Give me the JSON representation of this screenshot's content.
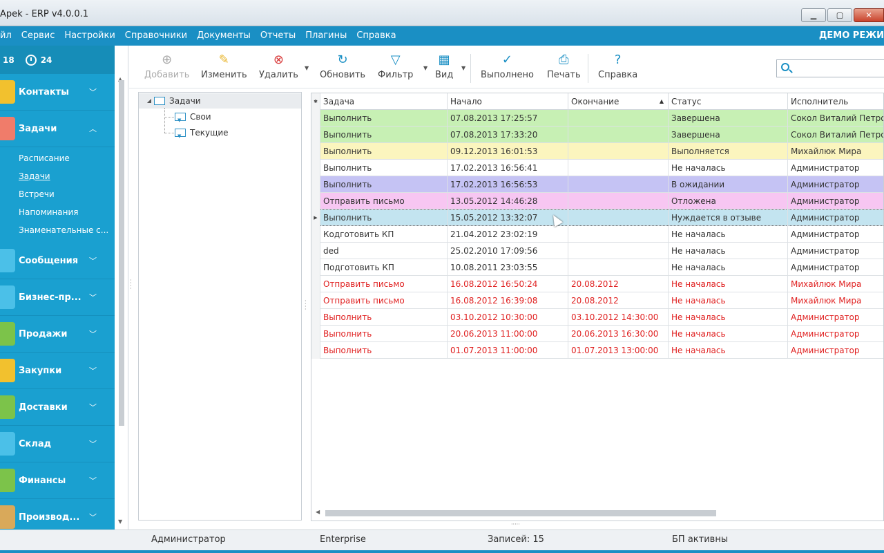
{
  "window": {
    "title": "Apek - ERP v4.0.0.1",
    "buttons": [
      {
        "name": "minimize-button",
        "glyph": "▁"
      },
      {
        "name": "maximize-button",
        "glyph": "▢"
      },
      {
        "name": "close-button",
        "glyph": "✕"
      }
    ]
  },
  "menubar": {
    "items": [
      "йл",
      "Сервис",
      "Настройки",
      "Справочники",
      "Документы",
      "Отчеты",
      "Плагины",
      "Справка"
    ],
    "mode_label": "ДЕМО РЕЖИ"
  },
  "sidebar": {
    "counter_left": "18",
    "counter_right": "24",
    "sections": [
      {
        "label": "Контакты",
        "color": "#f2c12e",
        "icon": "contacts-icon"
      },
      {
        "label": "Задачи",
        "color": "#f07c6a",
        "icon": "tasks-icon",
        "expanded": true,
        "items": [
          "Расписание",
          "Задачи",
          "Встречи",
          "Напоминания",
          "Знаменательные с..."
        ],
        "active_item": 1
      },
      {
        "label": "Сообщения",
        "color": "#4bc0e8",
        "icon": "messages-icon"
      },
      {
        "label": "Бизнес-пр...",
        "color": "#4bc0e8",
        "icon": "business-process-icon"
      },
      {
        "label": "Продажи",
        "color": "#7cc34a",
        "icon": "sales-icon"
      },
      {
        "label": "Закупки",
        "color": "#f2c12e",
        "icon": "purchases-icon"
      },
      {
        "label": "Доставки",
        "color": "#7cc34a",
        "icon": "delivery-icon"
      },
      {
        "label": "Склад",
        "color": "#4bc0e8",
        "icon": "warehouse-icon"
      },
      {
        "label": "Финансы",
        "color": "#7cc34a",
        "icon": "finance-icon"
      },
      {
        "label": "Производ...",
        "color": "#d9a95a",
        "icon": "production-icon"
      }
    ]
  },
  "toolbar": {
    "buttons": [
      {
        "label": "Добавить",
        "icon": "plus-icon",
        "glyph": "⊕",
        "color": "#aaaaaa",
        "disabled": true
      },
      {
        "label": "Изменить",
        "icon": "pencil-icon",
        "glyph": "✎",
        "color": "#e8b42a"
      },
      {
        "label": "Удалить",
        "icon": "delete-icon",
        "glyph": "⊗",
        "color": "#d83a3a",
        "dropdown": true
      },
      {
        "label": "Обновить",
        "icon": "refresh-icon",
        "glyph": "↻",
        "color": "#1a8fc4"
      },
      {
        "label": "Фильтр",
        "icon": "filter-icon",
        "glyph": "▽",
        "color": "#1a8fc4",
        "dropdown": true
      },
      {
        "label": "Вид",
        "icon": "view-icon",
        "glyph": "▦",
        "color": "#1a8fc4",
        "dropdown": true
      },
      {
        "label": "Выполнено",
        "icon": "check-icon",
        "glyph": "✓",
        "color": "#1a8fc4"
      },
      {
        "label": "Печать",
        "icon": "print-icon",
        "glyph": "⎙",
        "color": "#1a8fc4"
      },
      {
        "label": "Справка",
        "icon": "help-icon",
        "glyph": "?",
        "color": "#1a8fc4"
      }
    ],
    "search": {
      "value": "",
      "placeholder": ""
    }
  },
  "tree": {
    "root": "Задачи",
    "children": [
      "Свои",
      "Текущие"
    ]
  },
  "grid": {
    "columns": [
      "Задача",
      "Начало",
      "Окончание",
      "Статус",
      "Исполнитель"
    ],
    "sorted_column_glyph": "▲",
    "rows": [
      {
        "task": "Выполнить",
        "start": "07.08.2013 17:25:57",
        "end": "",
        "status": "Завершена",
        "assignee": "Сокол Виталий Петро",
        "bg": "#c7f0b4",
        "fg": "#333333"
      },
      {
        "task": "Выполнить",
        "start": "07.08.2013 17:33:20",
        "end": "",
        "status": "Завершена",
        "assignee": "Сокол Виталий Петро",
        "bg": "#c7f0b4",
        "fg": "#333333"
      },
      {
        "task": "Выполнить",
        "start": "09.12.2013 16:01:53",
        "end": "",
        "status": "Выполняется",
        "assignee": "Михайлюк Мира",
        "bg": "#fbf5be",
        "fg": "#333333"
      },
      {
        "task": "Выполнить",
        "start": "17.02.2013 16:56:41",
        "end": "",
        "status": "Не началась",
        "assignee": "Администратор",
        "bg": "#ffffff",
        "fg": "#333333"
      },
      {
        "task": "Выполнить",
        "start": "17.02.2013 16:56:53",
        "end": "",
        "status": "В ожидании",
        "assignee": "Администратор",
        "bg": "#c5c3f4",
        "fg": "#333333"
      },
      {
        "task": "Отправить письмо",
        "start": "13.05.2012 14:46:28",
        "end": "",
        "status": "Отложена",
        "assignee": "Администратор",
        "bg": "#f7c6f2",
        "fg": "#333333"
      },
      {
        "task": "Выполнить",
        "start": "15.05.2012 13:32:07",
        "end": "",
        "status": "Нуждается в отзыве",
        "assignee": "Администратор",
        "bg": "#c3e4f0",
        "fg": "#333333",
        "current": true
      },
      {
        "task": "Кодготовить КП",
        "start": "21.04.2012 23:02:19",
        "end": "",
        "status": "Не началась",
        "assignee": "Администратор",
        "bg": "#ffffff",
        "fg": "#333333"
      },
      {
        "task": "ded",
        "start": "25.02.2010 17:09:56",
        "end": "",
        "status": "Не началась",
        "assignee": "Администратор",
        "bg": "#ffffff",
        "fg": "#333333"
      },
      {
        "task": "Подготовить КП",
        "start": "10.08.2011 23:03:55",
        "end": "",
        "status": "Не началась",
        "assignee": "Администратор",
        "bg": "#ffffff",
        "fg": "#333333"
      },
      {
        "task": "Отправить письмо",
        "start": "16.08.2012 16:50:24",
        "end": "20.08.2012",
        "status": "Не началась",
        "assignee": "Михайлюк Мира",
        "bg": "#ffffff",
        "fg": "#e02020"
      },
      {
        "task": "Отправить письмо",
        "start": "16.08.2012 16:39:08",
        "end": "20.08.2012",
        "status": "Не началась",
        "assignee": "Михайлюк Мира",
        "bg": "#ffffff",
        "fg": "#e02020"
      },
      {
        "task": "Выполнить",
        "start": "03.10.2012 10:30:00",
        "end": "03.10.2012 14:30:00",
        "status": "Не началась",
        "assignee": "Администратор",
        "bg": "#ffffff",
        "fg": "#e02020"
      },
      {
        "task": "Выполнить",
        "start": "20.06.2013 11:00:00",
        "end": "20.06.2013 16:30:00",
        "status": "Не началась",
        "assignee": "Администратор",
        "bg": "#ffffff",
        "fg": "#e02020"
      },
      {
        "task": "Выполнить",
        "start": "01.07.2013 11:00:00",
        "end": "01.07.2013 13:00:00",
        "status": "Не началась",
        "assignee": "Администратор",
        "bg": "#ffffff",
        "fg": "#e02020"
      }
    ]
  },
  "statusbar": {
    "user": "Администратор",
    "edition": "Enterprise",
    "records": "Записей: 15",
    "bp_status": "БП активны"
  },
  "colors": {
    "accent": "#1a8fc4",
    "sidebar": "#1aa0d0",
    "overdue_text": "#e02020"
  }
}
